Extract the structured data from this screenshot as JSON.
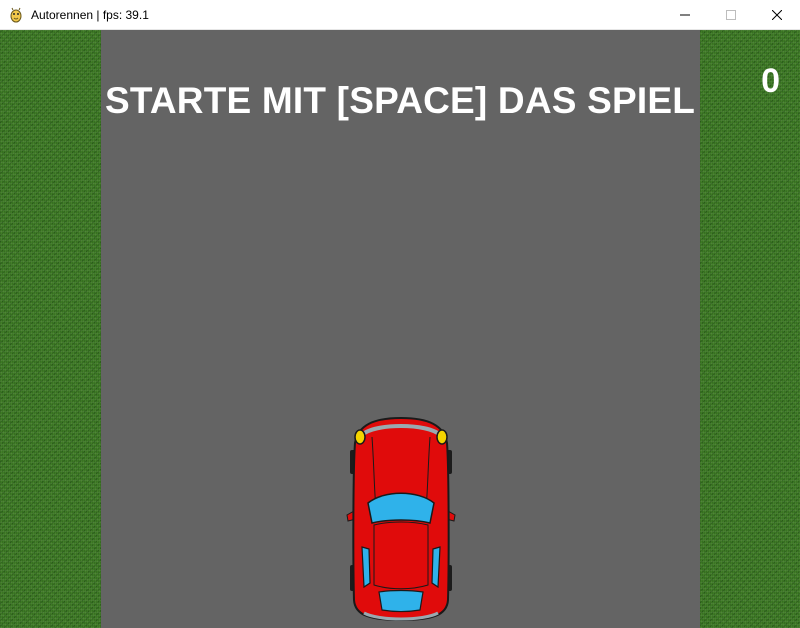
{
  "window": {
    "title": "Autorennen | fps: 39.1",
    "app_icon": "pygame-snake-icon",
    "controls": [
      "minimize",
      "maximize",
      "close"
    ]
  },
  "game": {
    "start_message": "STARTE MIT [SPACE] DAS SPIEL",
    "score": "0",
    "player": "red-car",
    "colors": {
      "road": "#646464",
      "grass": "#3d7a25",
      "car_body": "#e00b0b",
      "car_windows": "#2fb2ea",
      "headlights": "#f4d400",
      "text": "#ffffff"
    }
  }
}
